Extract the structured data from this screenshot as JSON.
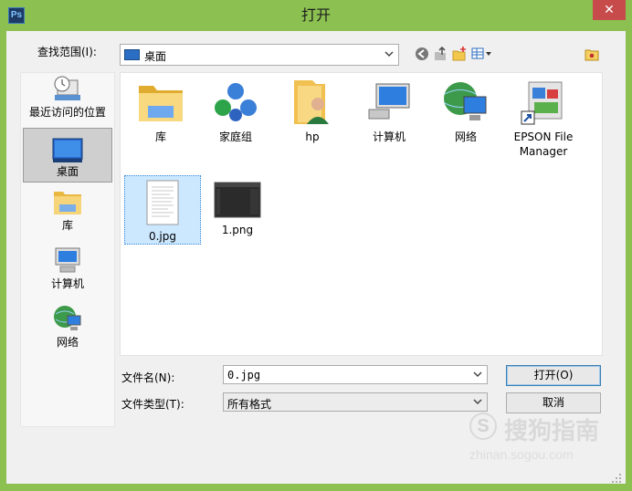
{
  "window": {
    "title": "打开",
    "app_icon_text": "Ps",
    "close_glyph": "✕"
  },
  "toolbar": {
    "lookin_label": "查找范围(I):",
    "lookin_value": "桌面"
  },
  "places": [
    {
      "label": "最近访问的位置",
      "icon": "recent-places-icon"
    },
    {
      "label": "桌面",
      "icon": "desktop-icon",
      "selected": true
    },
    {
      "label": "库",
      "icon": "library-icon"
    },
    {
      "label": "计算机",
      "icon": "computer-icon"
    },
    {
      "label": "网络",
      "icon": "network-icon"
    }
  ],
  "files": [
    {
      "name": "库",
      "icon": "library-folder-icon"
    },
    {
      "name": "家庭组",
      "icon": "homegroup-icon"
    },
    {
      "name": "hp",
      "icon": "user-folder-icon"
    },
    {
      "name": "计算机",
      "icon": "computer-icon"
    },
    {
      "name": "网络",
      "icon": "network-icon"
    },
    {
      "name": "EPSON File Manager",
      "icon": "epson-shortcut-icon"
    },
    {
      "name": "0.jpg",
      "icon": "jpg-thumbnail-icon",
      "selected": true
    },
    {
      "name": "1.png",
      "icon": "png-thumbnail-icon"
    }
  ],
  "form": {
    "filename_label": "文件名(N):",
    "filename_value": "0.jpg",
    "filetype_label": "文件类型(T):",
    "filetype_value": "所有格式"
  },
  "buttons": {
    "open": "打开(O)",
    "cancel": "取消"
  },
  "watermark": {
    "logo_letter": "S",
    "text": "搜狗指南",
    "url": "zhinan.sogou.com"
  },
  "colors": {
    "frame": "#8cc152",
    "close": "#c74b4b",
    "selection": "#cce8ff"
  }
}
